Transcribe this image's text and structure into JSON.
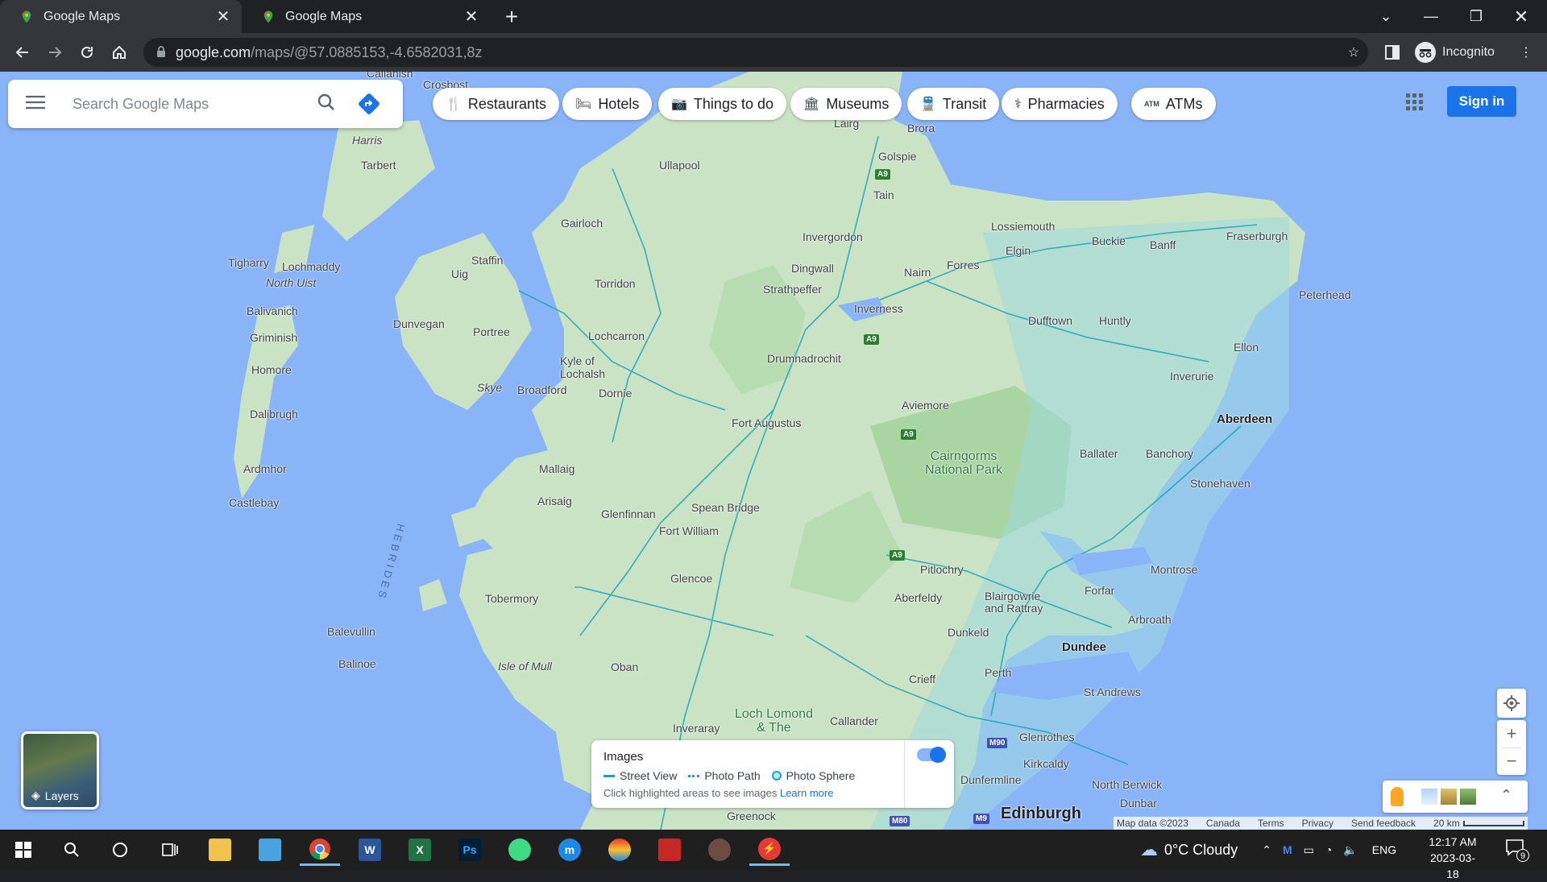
{
  "browser": {
    "tabs": [
      {
        "title": "Google Maps",
        "active": true
      },
      {
        "title": "Google Maps",
        "active": false
      }
    ],
    "url_host": "google.com",
    "url_path": "/maps/@57.0885153,-4.6582031,8z",
    "profile_label": "Incognito"
  },
  "maps": {
    "search_placeholder": "Search Google Maps",
    "chips": [
      "Restaurants",
      "Hotels",
      "Things to do",
      "Museums",
      "Transit",
      "Pharmacies",
      "ATMs"
    ],
    "sign_in": "Sign in",
    "layers_label": "Layers",
    "images_panel": {
      "title": "Images",
      "legend": [
        "Street View",
        "Photo Path",
        "Photo Sphere"
      ],
      "hint": "Click highlighted areas to see images",
      "learn_more": "Learn more",
      "toggle_on": true
    },
    "attribution": [
      "Map data ©2023",
      "Canada",
      "Terms",
      "Privacy",
      "Send feedback"
    ],
    "scale": "20 km",
    "places": {
      "callanish": "Callanish",
      "crosbost": "Crosbost",
      "harris": "Harris",
      "tarbert": "Tarbert",
      "lairg": "Lairg",
      "brora": "Brora",
      "golspie": "Golspie",
      "ullapool": "Ullapool",
      "tain": "Tain",
      "gairloch": "Gairloch",
      "invergordon": "Invergordon",
      "lossiemouth": "Lossiemouth",
      "buckie": "Buckie",
      "banff": "Banff",
      "fraserburgh": "Fraserburgh",
      "elgin": "Elgin",
      "forres": "Forres",
      "nairn": "Nairn",
      "dingwall": "Dingwall",
      "strathpeffer": "Strathpeffer",
      "tigharry": "Tigharry",
      "lochmaddy": "Lochmaddy",
      "north_uist": "North Uist",
      "staffin": "Staffin",
      "uig": "Uig",
      "torridon": "Torridon",
      "peterhead": "Peterhead",
      "inverness": "Inverness",
      "dufftown": "Dufftown",
      "huntly": "Huntly",
      "balivanich": "Balivanich",
      "dunvegan": "Dunvegan",
      "portree": "Portree",
      "lochcarron": "Lochcarron",
      "griminish": "Griminish",
      "ellon": "Ellon",
      "drumnadrochit": "Drumnadrochit",
      "kyle_of_lochalsh": "Kyle of\nLochalsh",
      "homore": "Homore",
      "inverurie": "Inverurie",
      "skye": "Skye",
      "broadford": "Broadford",
      "dornie": "Dornie",
      "aviemore": "Aviemore",
      "dalibrugh": "Dalibrugh",
      "aberdeen": "Aberdeen",
      "fort_augustus": "Fort Augustus",
      "cairngorms": "Cairngorms\nNational Park",
      "ballater": "Ballater",
      "banchory": "Banchory",
      "ardmhor": "Ardmhor",
      "mallaig": "Mallaig",
      "stonehaven": "Stonehaven",
      "castlebay": "Castlebay",
      "arisaig": "Arisaig",
      "spean_bridge": "Spean Bridge",
      "glenfinnan": "Glenfinnan",
      "fort_william": "Fort William",
      "hebrides": "HEBRIDES",
      "glencoe": "Glencoe",
      "pitlochry": "Pitlochry",
      "montrose": "Montrose",
      "forfar": "Forfar",
      "tobermory": "Tobermory",
      "aberfeldy": "Aberfeldy",
      "blairgowrie": "Blairgowrie\nand Rattray",
      "arbroath": "Arbroath",
      "balevullin": "Balevullin",
      "dunkeld": "Dunkeld",
      "dundee": "Dundee",
      "balinoe": "Balinoe",
      "isle_of_mull": "Isle of Mull",
      "oban": "Oban",
      "perth": "Perth",
      "crieff": "Crieff",
      "st_andrews": "St Andrews",
      "loch_lomond": "Loch Lomond\n& The",
      "inveraray": "Inveraray",
      "callander": "Callander",
      "glenrothes": "Glenrothes",
      "kirkcaldy": "Kirkcaldy",
      "north_berwick": "North Berwick",
      "dunfermline": "Dunfermline",
      "dunbar": "Dunbar",
      "greenock": "Greenock",
      "edinburgh": "Edinburgh"
    },
    "roads": {
      "a9": "A9",
      "m90": "M90",
      "m80": "M80",
      "m9": "M9"
    }
  },
  "taskbar": {
    "weather": "0°C  Cloudy",
    "lang": "ENG",
    "time": "12:17 AM",
    "date": "2023-03-18",
    "notifications": "9"
  }
}
